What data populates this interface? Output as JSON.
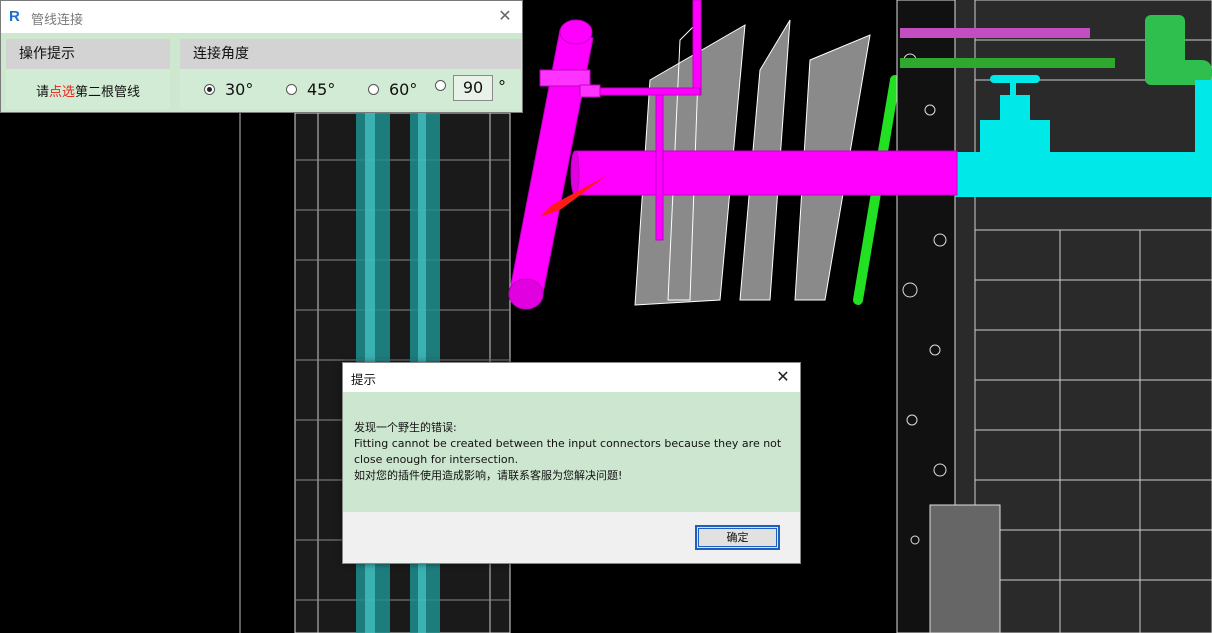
{
  "plugin_window": {
    "title": "管线连接",
    "app_icon": "revit-icon",
    "close_label": "✕",
    "hint_group": {
      "heading": "操作提示",
      "text_prefix": "请",
      "text_highlight": "点选",
      "text_suffix": "第二根管线"
    },
    "angle_group": {
      "heading": "连接角度",
      "options": [
        {
          "label": "30°",
          "selected": true
        },
        {
          "label": "45°",
          "selected": false
        },
        {
          "label": "60°",
          "selected": false
        },
        {
          "label": "",
          "selected": false
        }
      ],
      "custom_value": "90",
      "custom_suffix": "°"
    }
  },
  "dialog": {
    "title": "提示",
    "close_label": "✕",
    "lines": [
      "发现一个野生的错误:",
      "Fitting cannot be created between the input connectors because they are not",
      "close enough for intersection.",
      "如对您的插件使用造成影响，请联系客服为您解决问题!"
    ],
    "ok_label": "确定"
  },
  "colors": {
    "panel_green": "#cde8cf",
    "magenta_pipe": "#ff00ff",
    "cyan_pipe": "#00ffff",
    "green_pipe": "#22e022",
    "highlight_red": "#e8231d"
  }
}
